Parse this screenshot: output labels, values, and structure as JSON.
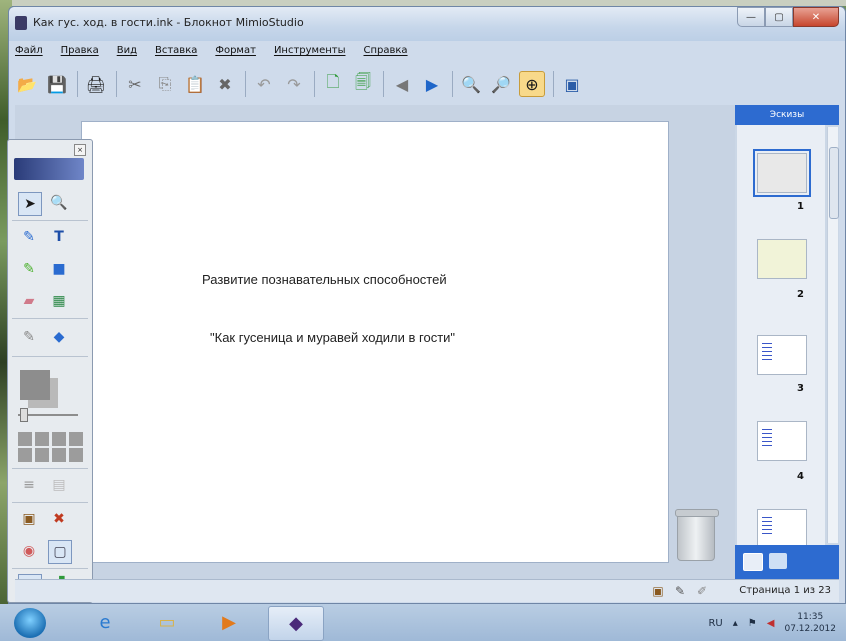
{
  "window": {
    "title": "Как гус. ход. в гости.ink - Блокнот MimioStudio",
    "controls": [
      "—",
      "▢",
      "✕"
    ]
  },
  "menu": [
    "Файл",
    "Правка",
    "Вид",
    "Вставка",
    "Формат",
    "Инструменты",
    "Справка"
  ],
  "toolbar": {
    "items": [
      {
        "icon": "open-icon",
        "glyph": "📂"
      },
      {
        "icon": "save-icon",
        "glyph": "💾"
      },
      {
        "icon": "print-icon",
        "glyph": "🖨"
      },
      {
        "icon": "cut-icon",
        "glyph": "✂"
      },
      {
        "icon": "copy-icon",
        "glyph": "⎘"
      },
      {
        "icon": "paste-icon",
        "glyph": "📋"
      },
      {
        "icon": "delete-icon",
        "glyph": "✖"
      },
      {
        "icon": "undo-icon",
        "glyph": "↶"
      },
      {
        "icon": "redo-icon",
        "glyph": "↷"
      },
      {
        "icon": "add-page-icon",
        "glyph": "🗋"
      },
      {
        "icon": "duplicate-page-icon",
        "glyph": "🗐"
      },
      {
        "icon": "prev-page-icon",
        "glyph": "◀"
      },
      {
        "icon": "next-page-icon",
        "glyph": "▶"
      },
      {
        "icon": "zoom-in-icon",
        "glyph": "🔍"
      },
      {
        "icon": "zoom-out-icon",
        "glyph": "🔎"
      },
      {
        "icon": "zoom-fit-icon",
        "glyph": "⊕"
      },
      {
        "icon": "view-icon",
        "glyph": "▣"
      }
    ]
  },
  "canvas": {
    "line1": "Развитие познавательных способностей",
    "line2": "\"Как гусеница и муравей ходили в гости\""
  },
  "thumbnails": {
    "header": "Эскизы",
    "pages": [
      "1",
      "2",
      "3",
      "4"
    ]
  },
  "status": {
    "page_info": "Страница 1 из 23"
  },
  "taskbar": {
    "lang": "RU",
    "time": "11:35",
    "date": "07.12.2012"
  },
  "colors": {
    "accent": "#2d6bd0",
    "window_bg": "#cfdbeb",
    "close_button": "#c7462d"
  }
}
